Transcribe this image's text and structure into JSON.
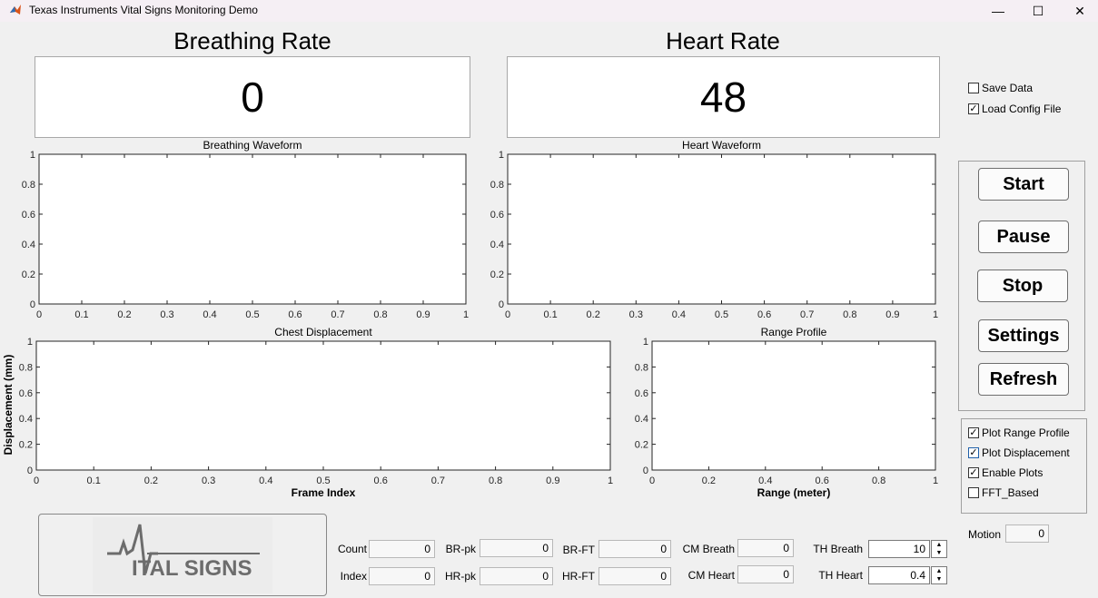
{
  "window": {
    "title": "Texas Instruments Vital Signs Monitoring Demo",
    "minimize_glyph": "—",
    "maximize_glyph": "☐",
    "close_glyph": "✕",
    "app_icon": "matlab-icon"
  },
  "breathing": {
    "heading": "Breathing Rate",
    "value": "0"
  },
  "heart": {
    "heading": "Heart Rate",
    "value": "48"
  },
  "top_options": [
    {
      "label": "Save Data",
      "checked": false
    },
    {
      "label": "Load Config File",
      "checked": true
    }
  ],
  "buttons": {
    "start": "Start",
    "pause": "Pause",
    "stop": "Stop",
    "settings": "Settings",
    "refresh": "Refresh"
  },
  "plot_options": [
    {
      "label": "Plot Range Profile",
      "checked": true
    },
    {
      "label": "Plot Displacement",
      "checked": true
    },
    {
      "label": "Enable Plots",
      "checked": true
    },
    {
      "label": "FFT_Based",
      "checked": false
    }
  ],
  "plots": {
    "breathing_waveform": {
      "title": "Breathing Waveform"
    },
    "heart_waveform": {
      "title": "Heart Waveform"
    },
    "chest_displacement": {
      "title": "Chest Displacement",
      "xlabel": "Frame Index",
      "ylabel": "Displacement (mm)"
    },
    "range_profile": {
      "title": "Range Profile",
      "xlabel": "Range (meter)"
    }
  },
  "chart_data": [
    {
      "type": "line",
      "title": "Breathing Waveform",
      "xlim": [
        0,
        1
      ],
      "ylim": [
        0,
        1
      ],
      "xticks": [
        "0",
        "0.1",
        "0.2",
        "0.3",
        "0.4",
        "0.5",
        "0.6",
        "0.7",
        "0.8",
        "0.9",
        "1"
      ],
      "yticks": [
        "0",
        "0.2",
        "0.4",
        "0.6",
        "0.8",
        "1"
      ],
      "series": []
    },
    {
      "type": "line",
      "title": "Heart Waveform",
      "xlim": [
        0,
        1
      ],
      "ylim": [
        0,
        1
      ],
      "xticks": [
        "0",
        "0.1",
        "0.2",
        "0.3",
        "0.4",
        "0.5",
        "0.6",
        "0.7",
        "0.8",
        "0.9",
        "1"
      ],
      "yticks": [
        "0",
        "0.2",
        "0.4",
        "0.6",
        "0.8",
        "1"
      ],
      "series": []
    },
    {
      "type": "line",
      "title": "Chest Displacement",
      "xlabel": "Frame Index",
      "ylabel": "Displacement (mm)",
      "xlim": [
        0,
        1
      ],
      "ylim": [
        0,
        1
      ],
      "xticks": [
        "0",
        "0.1",
        "0.2",
        "0.3",
        "0.4",
        "0.5",
        "0.6",
        "0.7",
        "0.8",
        "0.9",
        "1"
      ],
      "yticks": [
        "0",
        "0.2",
        "0.4",
        "0.6",
        "0.8",
        "1"
      ],
      "series": []
    },
    {
      "type": "line",
      "title": "Range Profile",
      "xlabel": "Range (meter)",
      "xlim": [
        0,
        1
      ],
      "ylim": [
        0,
        1
      ],
      "xticks": [
        "0",
        "0.2",
        "0.4",
        "0.6",
        "0.8",
        "1"
      ],
      "yticks": [
        "0",
        "0.2",
        "0.4",
        "0.6",
        "0.8",
        "1"
      ],
      "series": []
    }
  ],
  "logo": {
    "text": "ITAL SIGNS",
    "alt": "VITAL SIGNS"
  },
  "fields": {
    "count": {
      "label": "Count",
      "value": "0"
    },
    "index": {
      "label": "Index",
      "value": "0"
    },
    "br_pk": {
      "label": "BR-pk",
      "value": "0"
    },
    "hr_pk": {
      "label": "HR-pk",
      "value": "0"
    },
    "br_ft": {
      "label": "BR-FT",
      "value": "0"
    },
    "hr_ft": {
      "label": "HR-FT",
      "value": "0"
    },
    "cm_breath": {
      "label": "CM Breath",
      "value": "0"
    },
    "cm_heart": {
      "label": "CM  Heart",
      "value": "0"
    },
    "th_breath": {
      "label": "TH Breath",
      "value": "10"
    },
    "th_heart": {
      "label": "TH  Heart",
      "value": "0.4"
    },
    "motion": {
      "label": "Motion",
      "value": "0"
    }
  },
  "spinner": {
    "up": "▲",
    "down": "▼"
  }
}
